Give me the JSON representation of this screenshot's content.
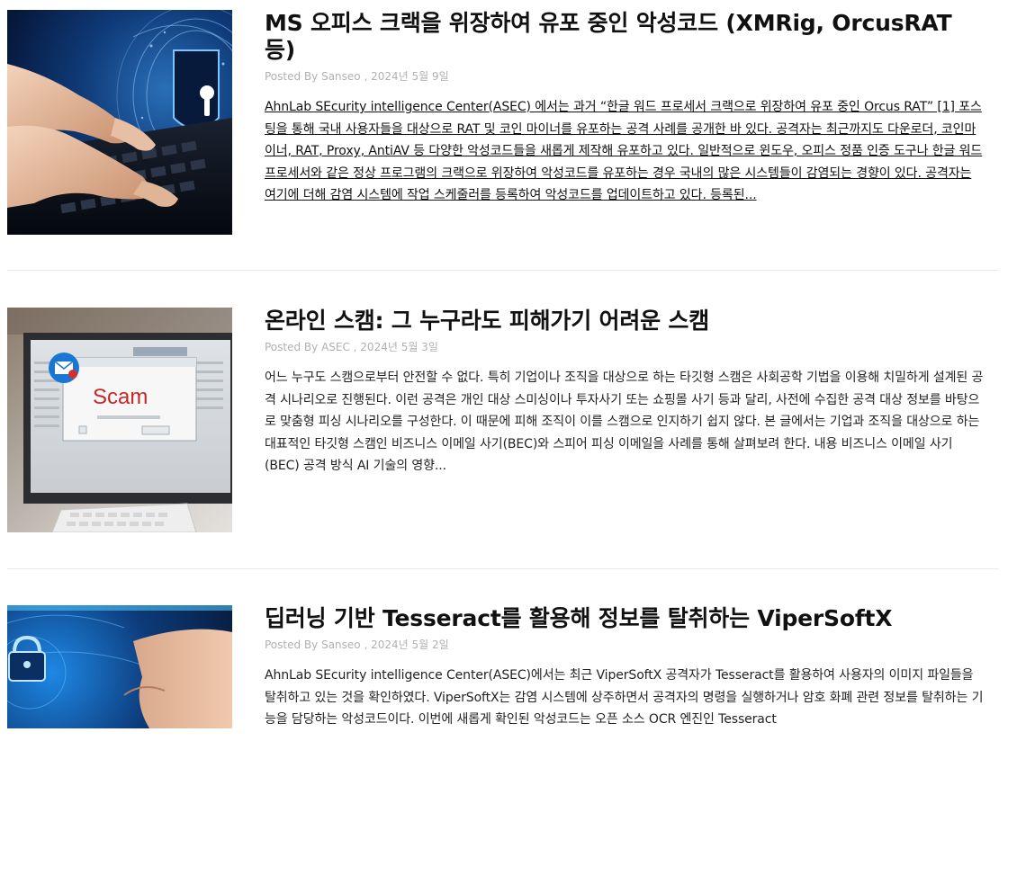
{
  "posts": [
    {
      "title": "MS 오피스 크랙을 위장하여 유포 중인 악성코드 (XMRig, OrcusRAT 등)",
      "meta": "Posted By Sanseo , 2024년 5월 9일",
      "excerpt": "AhnLab SEcurity intelligence Center(ASEC) 에서는 과거 “한글 워드 프로세서 크랙으로 위장하여 유포 중인 Orcus RAT” [1] 포스팅을 통해 국내 사용자들을 대상으로 RAT 및 코인 마이너를 유포하는 공격 사례를 공개한 바 있다. 공격자는 최근까지도 다운로더, 코인마이너, RAT, Proxy, AntiAV 등 다양한 악성코드들을 새롭게 제작해 유포하고 있다. 일반적으로 윈도우, 오피스 정품 인증 도구나 한글 워드 프로세서와 같은 정상 프로그램의 크랙으로 위장하여 악성코드를 유포하는 경우 국내의 많은 시스템들이 감염되는 경향이 있다. 공격자는 여기에 더해 감염 시스템에 작업 스케줄러를 등록하여 악성코드를 업데이트하고 있다. 등록된...",
      "image": "hands-keyboard-lock"
    },
    {
      "title": "온라인 스캠: 그 누구라도 피해가기 어려운 스캠",
      "meta": "Posted By ASEC , 2024년 5월 3일",
      "excerpt": "어느 누구도 스캠으로부터 안전할 수 없다. 특히 기업이나 조직을 대상으로 하는 타깃형 스캠은 사회공학 기법을 이용해 치밀하게 설계된 공격 시나리오로 진행된다. 이런 공격은 개인 대상 스미싱이나 투자사기 또는 쇼핑몰 사기 등과 달리, 사전에 수집한 공격 대상 정보를 바탕으로 맞춤형 피싱 시나리오를 구성한다. 이 때문에 피해 조직이 이를 스캠으로 인지하기 쉽지 않다. 본 글에서는 기업과 조직을 대상으로 하는 대표적인 타깃형 스캠인 비즈니스 이메일 사기(BEC)와 스피어 피싱 이메일을 사례를 통해 살펴보려 한다. 내용 비즈니스 이메일 사기 (BEC) 공격 방식 AI 기술의 영향...",
      "image": "scam-monitor",
      "scam_word": "Scam"
    },
    {
      "title": "딥러닝 기반 Tesseract를 활용해 정보를 탈취하는 ViperSoftX",
      "meta": "Posted By Sanseo , 2024년 5월 2일",
      "excerpt": "AhnLab SEcurity intelligence Center(ASEC)에서는 최근 ViperSoftX 공격자가 Tesseract를 활용하여 사용자의 이미지 파일들을 탈취하고 있는 것을 확인하였다. ViperSoftX는 감염 시스템에 상주하면서 공격자의 명령을 실행하거나 암호 화폐 관련 정보를 탈취하는 기능을 담당하는 악성코드이다. 이번에 새롭게 확인된 악성코드는 오픈 소스 OCR 엔진인 Tesseract",
      "image": "blue-lock-digital"
    }
  ]
}
